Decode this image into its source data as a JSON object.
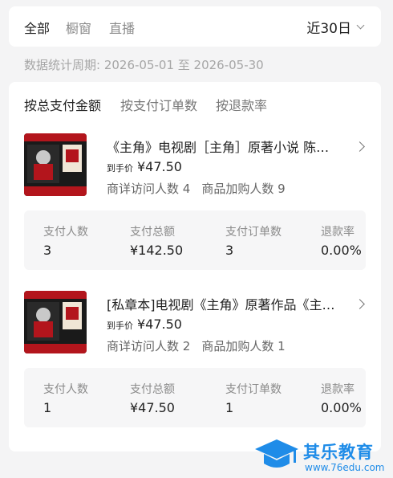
{
  "top_tabs": [
    "全部",
    "橱窗",
    "直播"
  ],
  "date_range": "近30日",
  "period_text": "数据统计周期: 2026-05-01 至 2026-05-30",
  "sort_tabs": [
    "按总支付金额",
    "按支付订单数",
    "按退款率"
  ],
  "products": [
    {
      "title": "《主角》电视剧［主角］原著小说 陈彦茅盾文学奖获奖作品",
      "price_label": "到手价",
      "price": "¥47.50",
      "visits": "商详访问人数 4",
      "cart_adds": "商品加购人数 9",
      "stats": {
        "headers": [
          "支付人数",
          "支付总额",
          "支付订单数",
          "退款率"
        ],
        "values": [
          "3",
          "¥142.50",
          "3",
          "0.00%"
        ]
      }
    },
    {
      "title": "[私章本]电视剧《主角》原著作品《主角》陈彦",
      "price_label": "到手价",
      "price": "¥47.50",
      "visits": "商详访问人数 2",
      "cart_adds": "商品加购人数 1",
      "stats": {
        "headers": [
          "支付人数",
          "支付总额",
          "支付订单数",
          "退款率"
        ],
        "values": [
          "1",
          "¥47.50",
          "1",
          "0.00%"
        ]
      }
    }
  ],
  "watermark": {
    "name": "其乐教育",
    "url": "www.76edu.com"
  },
  "colors": {
    "accent_blue": "#1f8ce8",
    "book_red": "#b3151c"
  }
}
